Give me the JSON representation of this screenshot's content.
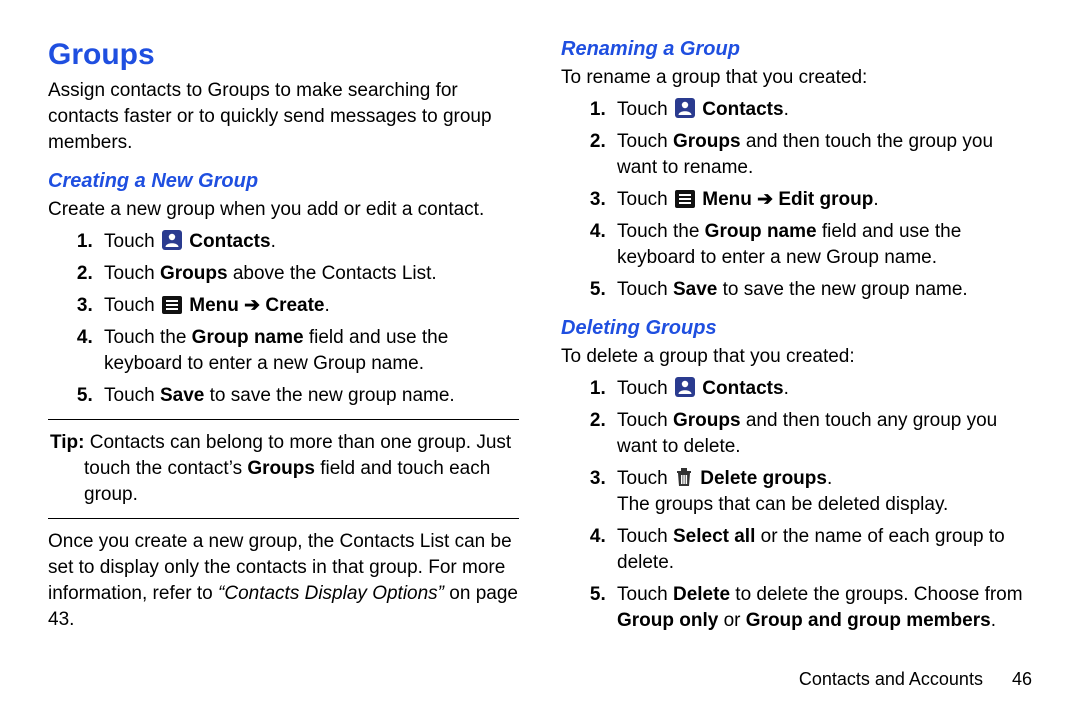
{
  "h1": "Groups",
  "footer": {
    "chapter": "Contacts and Accounts",
    "page": "46"
  },
  "left": {
    "intro": "Assign contacts to Groups to make searching for contacts faster or to quickly send messages to group members.",
    "creating": {
      "title": "Creating a New Group",
      "lead": "Create a new group when you add or edit a contact.",
      "s1_a": "Touch ",
      "s1_b": "Contacts",
      "s1_c": ".",
      "s2_a": "Touch ",
      "s2_b": "Groups",
      "s2_c": " above the Contacts List.",
      "s3_a": "Touch ",
      "s3_b": "Menu",
      "s3_arrow": " ➔ ",
      "s3_c": "Create",
      "s3_d": ".",
      "s4_a": "Touch the ",
      "s4_b": "Group name",
      "s4_c": " field and use the keyboard to enter a new Group name.",
      "s5_a": "Touch ",
      "s5_b": "Save",
      "s5_c": " to save the new group name."
    },
    "tip": {
      "label": "Tip:",
      "rest": " Contacts can belong to more than one group. Just touch the contact’s ",
      "bold": "Groups",
      "rest2": " field and touch each group."
    },
    "post": {
      "a": "Once you create a new group, the Contacts List can be set to display only the contacts in that group. For more information, refer to ",
      "ref": "“Contacts Display Options”",
      "b": " on page 43."
    }
  },
  "right": {
    "renaming": {
      "title": "Renaming a Group",
      "lead": "To rename a group that you created:",
      "s1_a": "Touch ",
      "s1_b": "Contacts",
      "s1_c": ".",
      "s2_a": "Touch ",
      "s2_b": "Groups",
      "s2_c": " and then touch the group you want to rename.",
      "s3_a": "Touch ",
      "s3_b": "Menu",
      "s3_arrow": " ➔ ",
      "s3_c": "Edit group",
      "s3_d": ".",
      "s4_a": "Touch the ",
      "s4_b": "Group name",
      "s4_c": " field and use the keyboard to enter a new Group name.",
      "s5_a": "Touch ",
      "s5_b": "Save",
      "s5_c": " to save the new group name."
    },
    "deleting": {
      "title": "Deleting Groups",
      "lead": "To delete a group that you created:",
      "s1_a": "Touch ",
      "s1_b": "Contacts",
      "s1_c": ".",
      "s2_a": "Touch ",
      "s2_b": "Groups",
      "s2_c": " and then touch any group you want to delete.",
      "s3_a": "Touch ",
      "s3_b": "Delete groups",
      "s3_c": ". ",
      "s3_follow": "The groups that can be deleted display.",
      "s4_a": "Touch ",
      "s4_b": "Select all",
      "s4_c": " or the name of each group to delete.",
      "s5_a": "Touch ",
      "s5_b": "Delete",
      "s5_c": " to delete the groups. Choose from ",
      "s5_d": "Group only",
      "s5_e": " or ",
      "s5_f": "Group and group members",
      "s5_g": "."
    }
  }
}
